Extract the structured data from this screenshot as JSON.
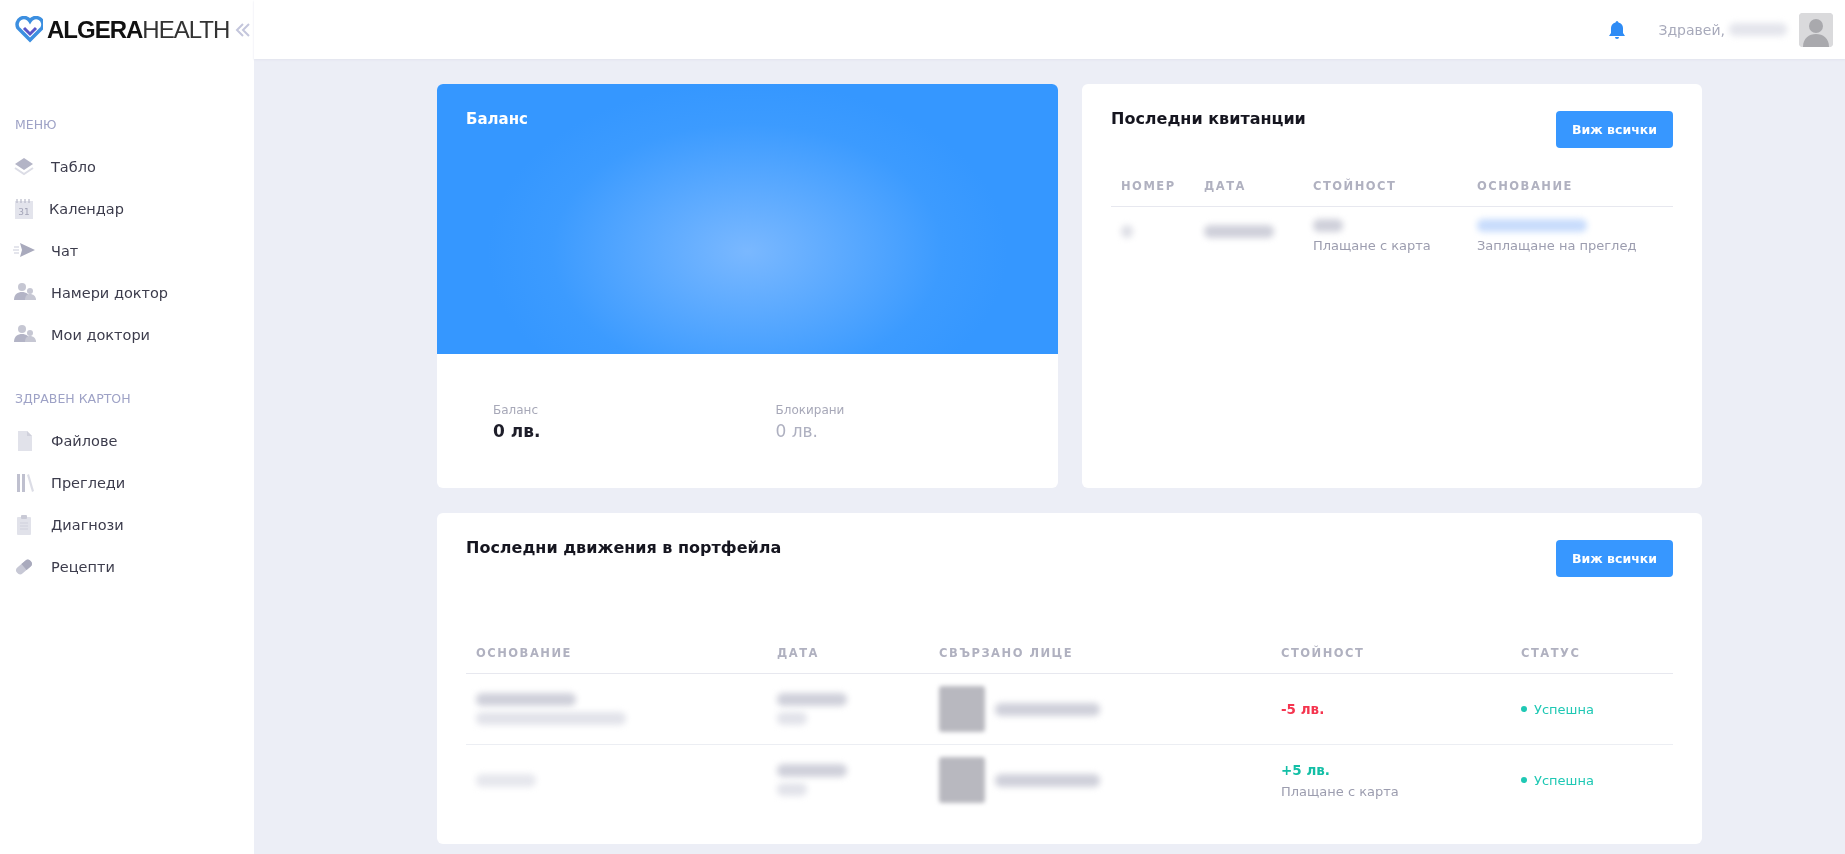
{
  "sidebar": {
    "logo": {
      "bold": "ALGERA",
      "light": "HEALTH"
    },
    "sections": [
      {
        "title": "МЕНЮ",
        "items": [
          {
            "label": "Табло"
          },
          {
            "label": "Календар",
            "icon_text": "31"
          },
          {
            "label": "Чат"
          },
          {
            "label": "Намери доктор"
          },
          {
            "label": "Мои доктори"
          }
        ]
      },
      {
        "title": "ЗДРАВЕН КАРТОН",
        "items": [
          {
            "label": "Файлове"
          },
          {
            "label": "Прегледи"
          },
          {
            "label": "Диагнози"
          },
          {
            "label": "Рецепти"
          }
        ]
      }
    ]
  },
  "header": {
    "greeting": "Здравей,"
  },
  "balance": {
    "title": "Баланс",
    "stats": [
      {
        "label": "Баланс",
        "value": "0 лв.",
        "kind": "primary"
      },
      {
        "label": "Блокирани",
        "value": "0 лв.",
        "kind": "muted"
      }
    ]
  },
  "receipts": {
    "title": "Последни квитанции",
    "button": "Виж всички",
    "columns": [
      "НОМЕР",
      "ДАТА",
      "СТОЙНОСТ",
      "ОСНОВАНИЕ"
    ],
    "rows": [
      {
        "value_note": "Плащане с карта",
        "reason_note": "Заплащане на преглед"
      }
    ]
  },
  "movements": {
    "title": "Последни движения в портфейла",
    "button": "Виж всички",
    "columns": [
      "ОСНОВАНИЕ",
      "ДАТА",
      "СВЪРЗАНО ЛИЦЕ",
      "СТОЙНОСТ",
      "СТАТУС"
    ],
    "rows": [
      {
        "amount": "-5 лв.",
        "kind": "debit",
        "status": "Успешна",
        "color": "#1fc8b4"
      },
      {
        "amount": "+5 лв.",
        "kind": "credit",
        "note": "Плащане с карта",
        "status": "Успешна",
        "color": "#1fc8b4"
      }
    ]
  }
}
